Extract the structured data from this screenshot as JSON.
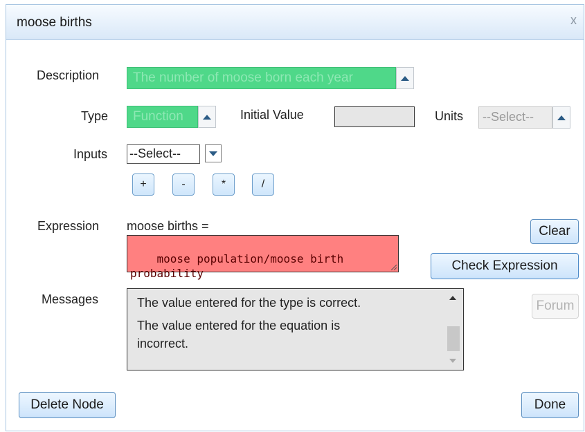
{
  "dialog": {
    "title": "moose births",
    "close_glyph": "x"
  },
  "description": {
    "label": "Description",
    "value": "The number of moose born each year"
  },
  "type": {
    "label": "Type",
    "value": "Function"
  },
  "initial_value": {
    "label": "Initial Value",
    "value": ""
  },
  "units": {
    "label": "Units",
    "selected": "--Select--"
  },
  "inputs": {
    "label": "Inputs",
    "selected": "--Select--",
    "operators": [
      "+",
      "-",
      "*",
      "/"
    ]
  },
  "expression": {
    "label": "Expression",
    "lhs": "moose births =",
    "value": "moose population/moose birth probability",
    "clear_label": "Clear",
    "check_label": "Check Expression"
  },
  "messages": {
    "label": "Messages",
    "lines": [
      "The value entered for the type is correct.",
      "The value entered for the equation is",
      "incorrect."
    ],
    "forum_label": "Forum"
  },
  "footer": {
    "delete_label": "Delete Node",
    "done_label": "Done"
  },
  "colors": {
    "correct_field": "#4fd889",
    "incorrect_field": "#ff8080",
    "button_border": "#5d8fc0"
  }
}
